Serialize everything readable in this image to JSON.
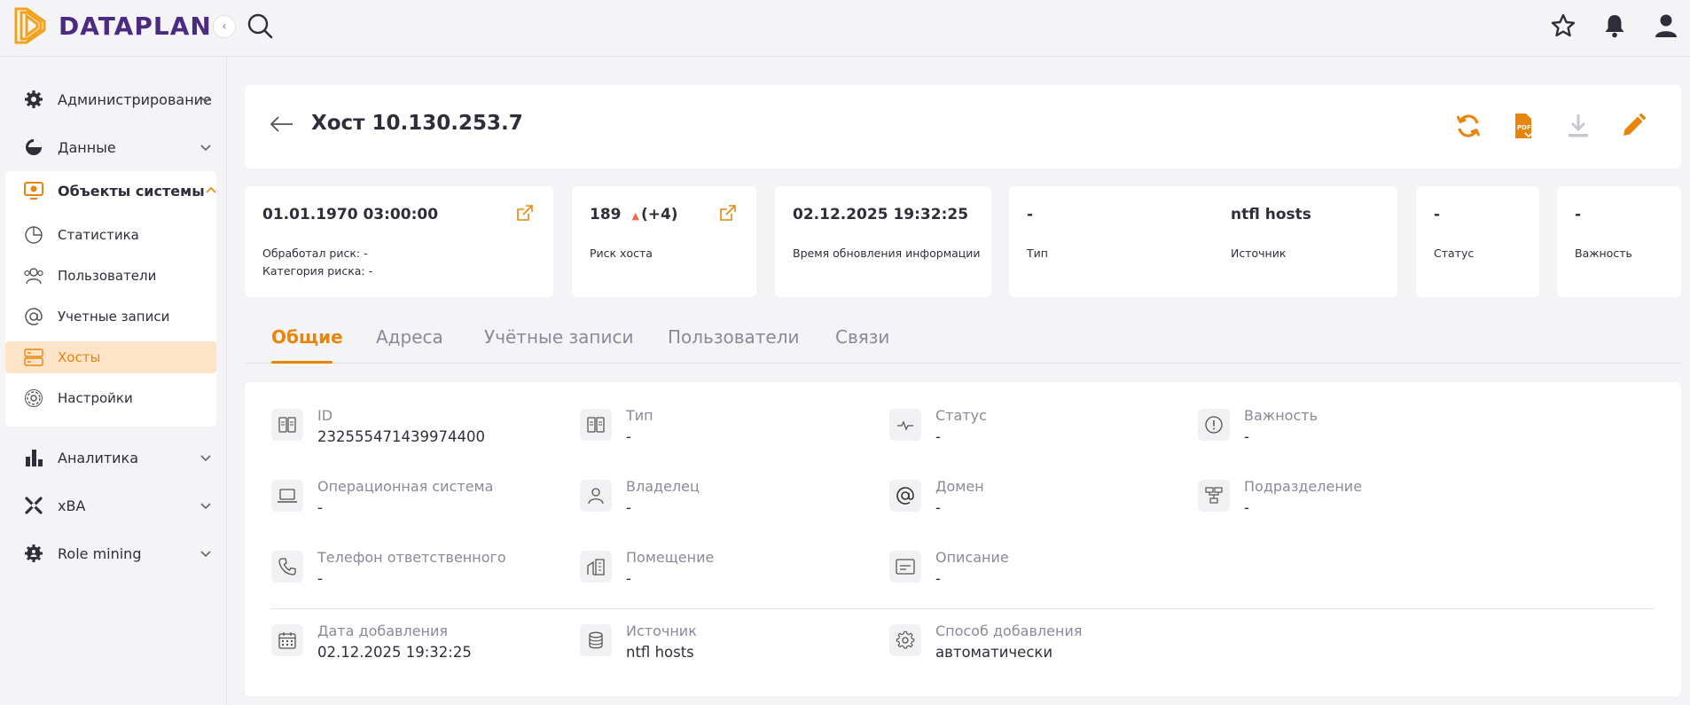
{
  "app": {
    "brand": "DATAPLAN",
    "accent": "#e8850e",
    "brand_color": "#4b2a82"
  },
  "topbar": {
    "icons": [
      "search-icon",
      "star-icon",
      "bell-icon",
      "user-icon"
    ]
  },
  "sidebar": {
    "items": [
      {
        "label": "Администрирование",
        "icon": "gear-icon"
      },
      {
        "label": "Данные",
        "icon": "pie-icon"
      },
      {
        "label": "Объекты системы",
        "icon": "monitor-gear-icon"
      },
      {
        "label": "Аналитика",
        "icon": "bar-chart-icon"
      },
      {
        "label": "xBA",
        "icon": "xba-icon"
      },
      {
        "label": "Role mining",
        "icon": "cog-people-icon"
      }
    ],
    "subitems": [
      {
        "label": "Статистика",
        "icon": "pie-chart-icon"
      },
      {
        "label": "Пользователи",
        "icon": "users-icon"
      },
      {
        "label": "Учетные записи",
        "icon": "at-icon"
      },
      {
        "label": "Хосты",
        "icon": "server-icon"
      },
      {
        "label": "Настройки",
        "icon": "settings-icon"
      }
    ]
  },
  "header": {
    "title": "Хост 10.130.253.7"
  },
  "cards": {
    "processed": {
      "value": "01.01.1970 03:00:00",
      "line1": "Обработал риск: -",
      "line2": "Категория риска: -"
    },
    "risk": {
      "value": "189",
      "delta": "(+4)",
      "caption": "Риск хоста"
    },
    "updated": {
      "value": "02.12.2025 19:32:25",
      "caption": "Время обновления информации"
    },
    "type": {
      "value": "-",
      "caption": "Тип"
    },
    "source": {
      "value": "ntfl hosts",
      "caption": "Источник"
    },
    "status": {
      "value": "-",
      "caption": "Статус"
    },
    "importance": {
      "value": "-",
      "caption": "Важность"
    }
  },
  "tabs": [
    "Общие",
    "Адреса",
    "Учётные записи",
    "Пользователи",
    "Связи"
  ],
  "fields": {
    "id": {
      "label": "ID",
      "value": "232555471439974400"
    },
    "type": {
      "label": "Тип",
      "value": "-"
    },
    "status": {
      "label": "Статус",
      "value": "-"
    },
    "importance": {
      "label": "Важность",
      "value": "-"
    },
    "os": {
      "label": "Операционная система",
      "value": "-"
    },
    "owner": {
      "label": "Владелец",
      "value": "-"
    },
    "domain": {
      "label": "Домен",
      "value": "-"
    },
    "division": {
      "label": "Подразделение",
      "value": "-"
    },
    "phone": {
      "label": "Телефон ответственного",
      "value": "-"
    },
    "room": {
      "label": "Помещение",
      "value": "-"
    },
    "description": {
      "label": "Описание",
      "value": "-"
    },
    "added": {
      "label": "Дата добавления",
      "value": "02.12.2025 19:32:25"
    },
    "source": {
      "label": "Источник",
      "value": "ntfl hosts"
    },
    "method": {
      "label": "Способ добавления",
      "value": "автоматически"
    }
  }
}
